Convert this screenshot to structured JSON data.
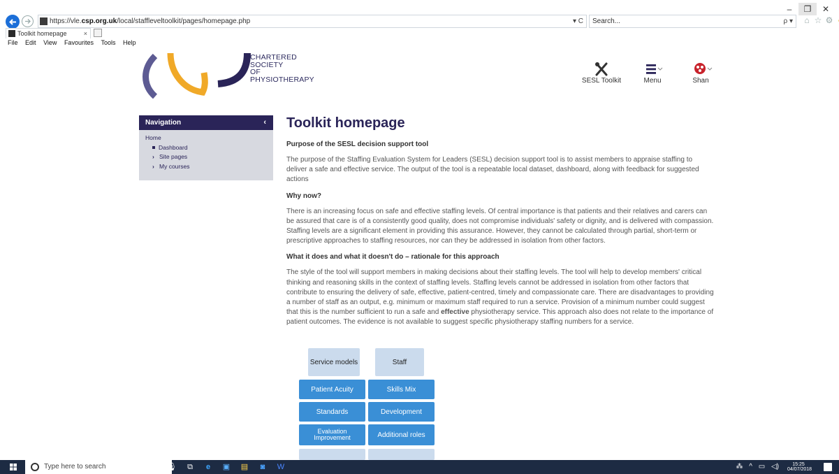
{
  "browser": {
    "url_prefix": "https://vle.",
    "url_domain": "csp.org.uk",
    "url_path": "/local/staffleveltoolkit/pages/homepage.php",
    "url_controls": "▾ C",
    "search_placeholder": "Search...",
    "search_icon_label": "ρ ▾",
    "tab_title": "Toolkit homepage",
    "tab_close": "×",
    "menubar": [
      "File",
      "Edit",
      "View",
      "Favourites",
      "Tools",
      "Help"
    ]
  },
  "header": {
    "logo_lines": [
      "CHARTERED",
      "SOCIETY",
      "OF",
      "PHYSIOTHERAPY"
    ],
    "toolkit_label": "SESL Toolkit",
    "menu_label": "Menu",
    "user_label": "Shan"
  },
  "nav": {
    "title": "Navigation",
    "collapse_icon": "‹",
    "home": "Home",
    "items": [
      "Dashboard",
      "Site pages",
      "My courses"
    ]
  },
  "main": {
    "title": "Toolkit homepage",
    "h_purpose": "Purpose of the SESL decision support tool",
    "p_purpose": "The purpose of the Staffing Evaluation System for Leaders (SESL) decision support tool is to assist members to appraise staffing to deliver a safe and effective service. The output of the tool is a repeatable local dataset, dashboard, along with feedback for suggested actions",
    "h_why": "Why now?",
    "p_why": "There is an increasing focus on safe and effective staffing levels. Of central importance is that patients and their relatives and carers can be assured that care is of a consistently good quality, does not compromise individuals' safety or dignity, and is delivered with compassion. Staffing levels are a significant element in providing this assurance. However, they cannot be calculated through partial, short-term or prescriptive approaches to staffing resources, nor can they be addressed in isolation from other factors.",
    "h_what": "What it does and what it doesn't do – rationale for this approach",
    "p_what_a": "The style of the tool will support members in making decisions about their staffing levels. The tool will help to develop members' critical thinking and reasoning skills in the context of staffing levels. Staffing levels cannot be addressed in isolation from other factors that contribute to ensuring the delivery of safe, effective, patient-centred, timely and compassionate care. There are disadvantages to providing a number of staff as an output, e.g. minimum or maximum staff required to run a service. Provision of a minimum number could suggest that this is the number sufficient to run a safe and",
    "p_what_bold": "effective",
    "p_what_b": "physiotherapy service. This approach also does not relate to the importance of patient outcomes. The evidence is not available to suggest specific physiotherapy staffing numbers for a service."
  },
  "diagram": {
    "service_models": "Service models",
    "staff": "Staff",
    "patient_acuity": "Patient Acuity",
    "skills_mix": "Skills Mix",
    "standards": "Standards",
    "development": "Development",
    "evaluation": "Evaluation Improvement",
    "additional_roles": "Additional roles"
  },
  "taskbar": {
    "search_placeholder": "Type here to search",
    "time": "15:25",
    "date": "04/07/2018"
  },
  "colors": {
    "brand_navy": "#2a2458",
    "diagram_blue": "#3a8fd6",
    "diagram_light": "#cbdbed",
    "logo_gold": "#f0a928",
    "logo_purple": "#5d5b93"
  }
}
